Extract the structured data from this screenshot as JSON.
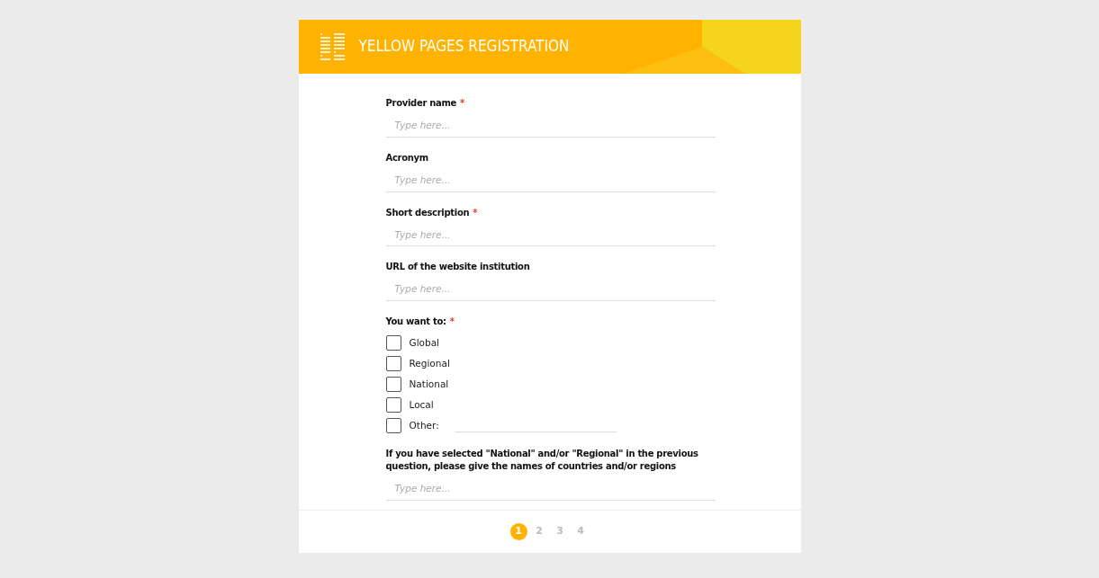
{
  "header": {
    "title": "YELLOW PAGES REGISTRATION"
  },
  "fields": [
    {
      "kind": "text",
      "label": "Provider name",
      "required_mark": "*",
      "placeholder": "Type here..."
    },
    {
      "kind": "text",
      "label": "Acronym",
      "placeholder": "Type here..."
    },
    {
      "kind": "text",
      "label": "Short description",
      "required_mark": "*",
      "placeholder": "Type here..."
    },
    {
      "kind": "text",
      "label": "URL of the website institution",
      "placeholder": "Type here..."
    },
    {
      "kind": "checkboxes",
      "label": "You want to:",
      "required_mark": "*",
      "options": [
        {
          "kind": "plain",
          "label": "Global",
          "checked": false
        },
        {
          "kind": "plain",
          "label": "Regional",
          "checked": false
        },
        {
          "kind": "plain",
          "label": "National",
          "checked": false
        },
        {
          "kind": "plain",
          "label": "Local",
          "checked": false
        },
        {
          "kind": "other",
          "label": "Other:",
          "checked": false
        }
      ]
    },
    {
      "kind": "text",
      "label": "If you have selected \"National\" and/or \"Regional\" in the previous question, please give the names of countries and/or regions",
      "placeholder": "Type here..."
    }
  ],
  "pages": [
    {
      "label": "1",
      "selected": true
    },
    {
      "label": "2",
      "selected": false
    },
    {
      "label": "3",
      "selected": false
    },
    {
      "label": "4",
      "selected": false
    }
  ]
}
